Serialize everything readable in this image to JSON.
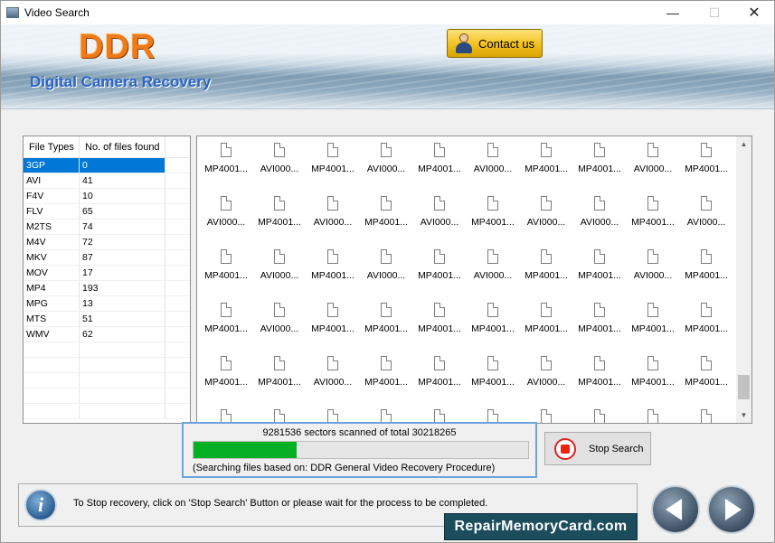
{
  "window": {
    "title": "Video Search",
    "minimize_glyph": "—",
    "maximize_glyph": "☐",
    "close_glyph": "✕"
  },
  "banner": {
    "logo": "DDR",
    "contact_label": "Contact us",
    "subtitle": "Digital Camera Recovery"
  },
  "file_types": {
    "headers": [
      "File Types",
      "No. of files found"
    ],
    "selected_index": 0,
    "rows": [
      {
        "type": "3GP",
        "count": "0"
      },
      {
        "type": "AVI",
        "count": "41"
      },
      {
        "type": "F4V",
        "count": "10"
      },
      {
        "type": "FLV",
        "count": "65"
      },
      {
        "type": "M2TS",
        "count": "74"
      },
      {
        "type": "M4V",
        "count": "72"
      },
      {
        "type": "MKV",
        "count": "87"
      },
      {
        "type": "MOV",
        "count": "17"
      },
      {
        "type": "MP4",
        "count": "193"
      },
      {
        "type": "MPG",
        "count": "13"
      },
      {
        "type": "MTS",
        "count": "51"
      },
      {
        "type": "WMV",
        "count": "62"
      }
    ]
  },
  "files": {
    "rows": [
      [
        "MP4001...",
        "AVI000...",
        "MP4001...",
        "AVI000...",
        "MP4001...",
        "AVI000...",
        "MP4001...",
        "MP4001...",
        "AVI000...",
        "MP4001..."
      ],
      [
        "AVI000...",
        "MP4001...",
        "AVI000...",
        "MP4001...",
        "AVI000...",
        "MP4001...",
        "AVI000...",
        "AVI000...",
        "MP4001...",
        "AVI000..."
      ],
      [
        "MP4001...",
        "AVI000...",
        "MP4001...",
        "AVI000...",
        "MP4001...",
        "AVI000...",
        "MP4001...",
        "MP4001...",
        "AVI000...",
        "MP4001..."
      ],
      [
        "MP4001...",
        "AVI000...",
        "MP4001...",
        "MP4001...",
        "MP4001...",
        "MP4001...",
        "MP4001...",
        "MP4001...",
        "MP4001...",
        "MP4001..."
      ],
      [
        "MP4001...",
        "MP4001...",
        "AVI000...",
        "MP4001...",
        "MP4001...",
        "MP4001...",
        "AVI000...",
        "MP4001...",
        "MP4001...",
        "MP4001..."
      ],
      [
        "",
        "",
        "",
        "",
        "",
        "",
        "",
        "",
        "",
        ""
      ]
    ]
  },
  "progress": {
    "status_text": "9281536 sectors scanned of total 30218265",
    "fraction": 0.307,
    "procedure_text": "(Searching files based on:  DDR General Video Recovery Procedure)"
  },
  "stop_button": {
    "label": "Stop Search"
  },
  "info": {
    "text": "To Stop recovery, click on 'Stop Search' Button or please wait for the process to be completed."
  },
  "watermark": "RepairMemoryCard.com",
  "colors": {
    "selection": "#0078d7",
    "progress": "#06b025",
    "logo": "#f07a18",
    "subtitle": "#2c63c6",
    "progress_border": "#6fa3de"
  }
}
